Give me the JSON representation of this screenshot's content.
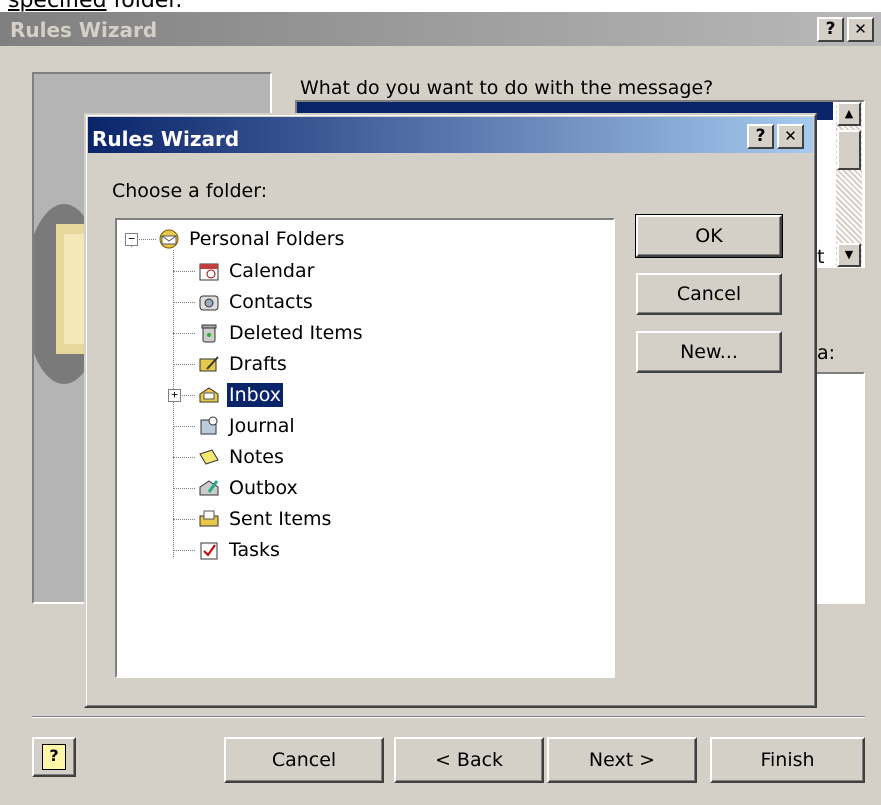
{
  "page_fragment": {
    "underlined": "specified",
    "rest": " folder."
  },
  "outer": {
    "title": "Rules Wizard",
    "help_button": "?",
    "close_button": "✕",
    "question": "What do you want to do with the message?",
    "partial_text_t": "t",
    "partial_label_colon": "a:",
    "buttons": {
      "help_icon": "?",
      "cancel": "Cancel",
      "back": "< Back",
      "next": "Next >",
      "finish": "Finish"
    }
  },
  "dialog": {
    "title": "Rules Wizard",
    "help_button": "?",
    "close_button": "✕",
    "prompt": "Choose a folder:",
    "buttons": {
      "ok": "OK",
      "cancel": "Cancel",
      "new": "New..."
    },
    "tree": {
      "root": "Personal Folders",
      "expander_root": "−",
      "expander_inbox": "+",
      "items": [
        {
          "label": "Calendar",
          "icon": "calendar-icon"
        },
        {
          "label": "Contacts",
          "icon": "contacts-icon"
        },
        {
          "label": "Deleted Items",
          "icon": "deleted-items-icon"
        },
        {
          "label": "Drafts",
          "icon": "drafts-icon"
        },
        {
          "label": "Inbox",
          "icon": "inbox-icon",
          "selected": true
        },
        {
          "label": "Journal",
          "icon": "journal-icon"
        },
        {
          "label": "Notes",
          "icon": "notes-icon"
        },
        {
          "label": "Outbox",
          "icon": "outbox-icon"
        },
        {
          "label": "Sent Items",
          "icon": "sent-items-icon"
        },
        {
          "label": "Tasks",
          "icon": "tasks-icon"
        }
      ]
    }
  },
  "colors": {
    "face": "#d4d0c8",
    "active_title": "#0a246a",
    "inactive_title": "#808080",
    "selection": "#0a246a"
  }
}
